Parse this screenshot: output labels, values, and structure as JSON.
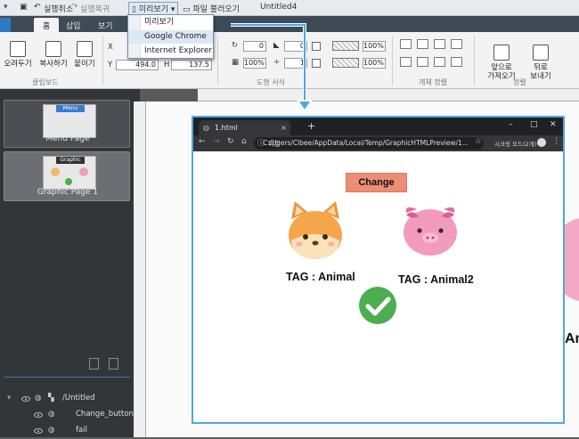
{
  "titlebar": {
    "undo": "실행취소",
    "redo": "실행복귀",
    "preview": "미리보기",
    "file_open": "파일 불러오기",
    "doc_title": "Untitled4"
  },
  "preview_menu": {
    "items": [
      "미리보기",
      "Google Chrome",
      "Internet Explorer"
    ],
    "highlighted_index": 1
  },
  "ribbon": {
    "tabs": [
      "홈",
      "삽입",
      "보기"
    ],
    "active_tab": "홈",
    "buttons": [
      "오려두기",
      "복사하기",
      "붙이기"
    ],
    "group_labels": [
      "클립보드",
      "도형 서식",
      "개체 정렬",
      "정렬"
    ],
    "x_label": "X",
    "y_label": "Y",
    "h_label": "H",
    "y_value": "494.0",
    "h_value": "137.5",
    "field_values": [
      "0",
      "0",
      "100%",
      "1",
      "0",
      "100%",
      "100%"
    ],
    "order_buttons": [
      "앞으로\n가져오기",
      "뒤로\n보내기"
    ]
  },
  "left_panel": {
    "pages": [
      {
        "thumb_title": "Menu",
        "label": "Menu Page"
      },
      {
        "thumb_title": "Graphic",
        "label": "Graphic Page 1"
      }
    ],
    "tree": [
      {
        "name": "/Untitled"
      },
      {
        "name": "Change_button"
      },
      {
        "name": "fail"
      }
    ]
  },
  "browser": {
    "tab_title": "1.html",
    "new_tab": "+",
    "url_prefix": "파일",
    "url": "C:/Users/Clbee/AppData/Local/Temp/GraphicHTMLPreview/1....",
    "mode_text": "시크릿 모드(2개)",
    "change_button": "Change",
    "tag1": "TAG : Animal",
    "tag2": "TAG : Animal2"
  },
  "colors": {
    "accent": "#4fa7de",
    "change_button": "#ec8e74",
    "check": "#4cae4f"
  }
}
